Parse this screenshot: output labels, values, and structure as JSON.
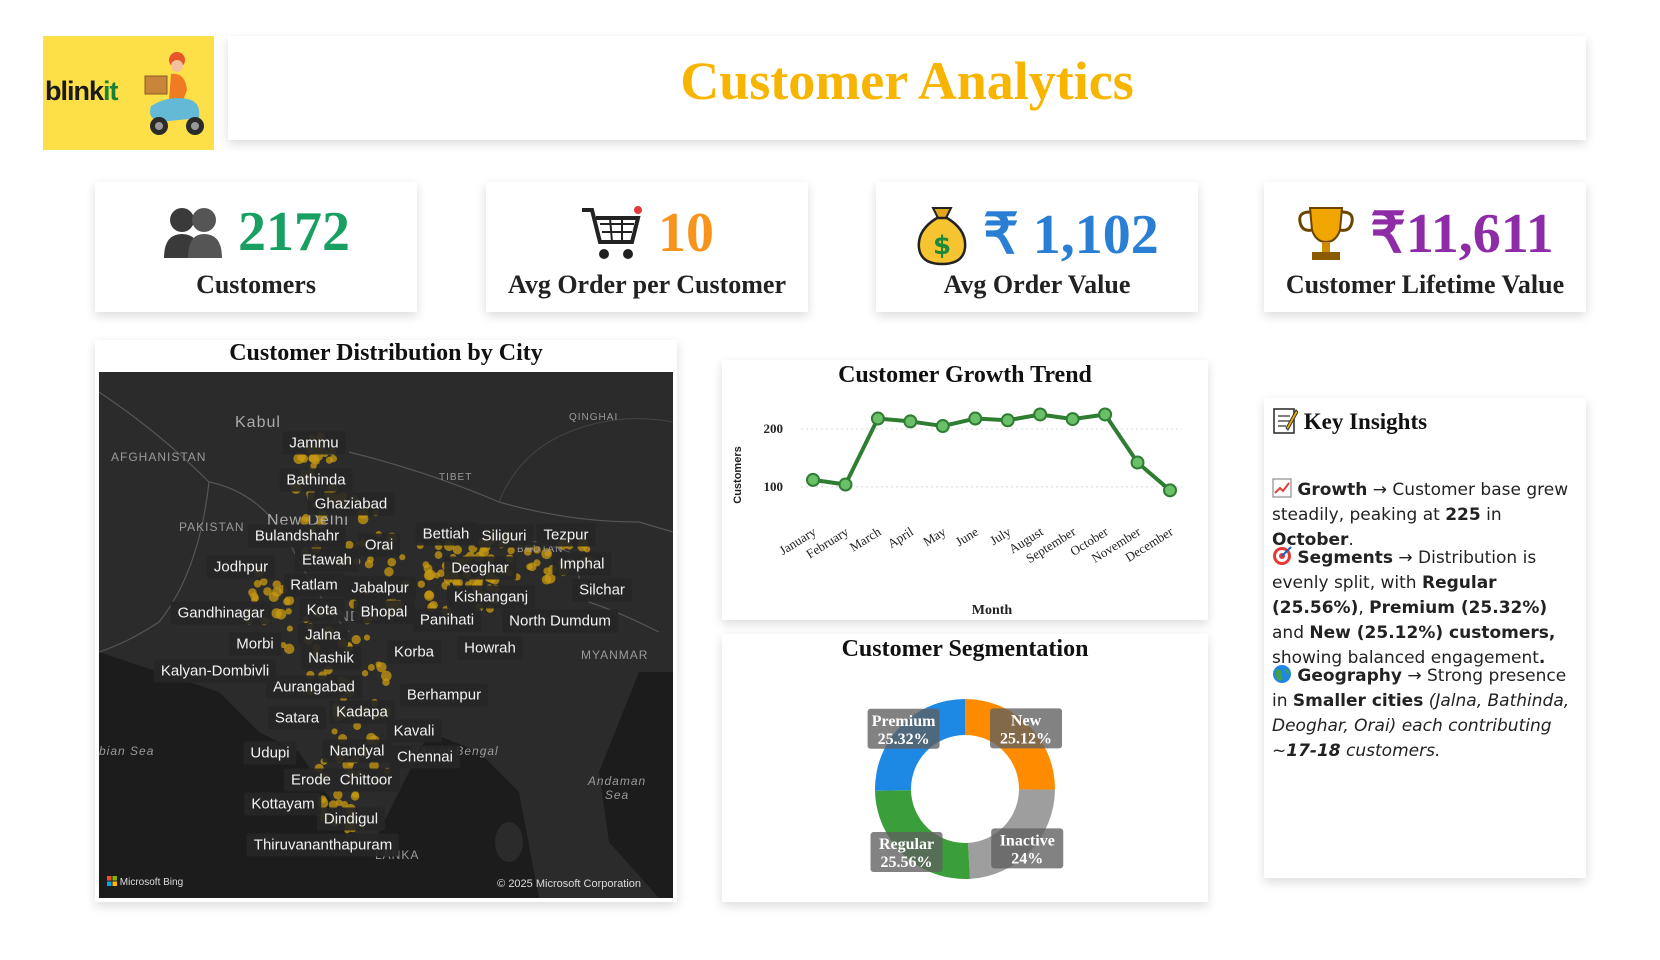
{
  "brand": {
    "logo_text_main": "blink",
    "logo_text_accent": "it",
    "scooter_icon": "delivery-scooter-icon"
  },
  "header": {
    "title": "Customer Analytics",
    "title_color": "#f7b500"
  },
  "kpis": [
    {
      "icon": "people-icon",
      "value": "2172",
      "label": "Customers",
      "color": "#17a061"
    },
    {
      "icon": "shopping-cart-icon",
      "value": "10",
      "label": "Avg Order per Customer",
      "color": "#f7941d"
    },
    {
      "icon": "money-bag-icon",
      "value": "₹ 1,102",
      "label": "Avg Order Value",
      "color": "#2a7fd4"
    },
    {
      "icon": "trophy-icon",
      "value": "₹11,611",
      "label": "Customer Lifetime Value",
      "color": "#8e2ca8"
    }
  ],
  "map": {
    "title": "Customer Distribution by City",
    "regions": [
      "AFGHANISTAN",
      "PAKISTAN",
      "Kabul",
      "TIBET",
      "QINGHAI",
      "BHUTAN",
      "MYANMAR",
      "LANKA",
      "bian Sea",
      "Andaman Sea",
      "Bay of Bengal",
      "New Delhi",
      "INDIA"
    ],
    "cities": [
      "Jammu",
      "Bathinda",
      "Ghaziabad",
      "Bulandshahr",
      "Orai",
      "Bettiah",
      "Siliguri",
      "Tezpur",
      "Etawah",
      "Jodhpur",
      "Deoghar",
      "Imphal",
      "Ratlam",
      "Jabalpur",
      "Silchar",
      "Kishanganj",
      "Gandhinagar",
      "Kota",
      "Bhopal",
      "Panihati",
      "North Dumdum",
      "Jalna",
      "Morbi",
      "Korba",
      "Howrah",
      "Nashik",
      "Kalyan-Dombivli",
      "Aurangabad",
      "Berhampur",
      "Kadapa",
      "Satara",
      "Kavali",
      "Udupi",
      "Nandyal",
      "Chennai",
      "Erode",
      "Chittoor",
      "Kottayam",
      "Dindigul",
      "Thiruvananthapuram"
    ],
    "attribution": "Microsoft Bing",
    "copyright": "© 2025 Microsoft Corporation"
  },
  "chart_data": [
    {
      "type": "line",
      "title": "Customer Growth Trend",
      "xlabel": "Month",
      "ylabel": "Customers",
      "categories": [
        "January",
        "February",
        "March",
        "April",
        "May",
        "June",
        "July",
        "August",
        "September",
        "October",
        "November",
        "December"
      ],
      "series": [
        {
          "values": [
            112,
            104,
            218,
            213,
            205,
            218,
            215,
            225,
            217,
            225,
            142,
            94
          ]
        }
      ],
      "yticks": [
        100,
        200
      ],
      "ylim": [
        60,
        250
      ],
      "grid": true,
      "color": "#2e7d32"
    },
    {
      "type": "pie",
      "title": "Customer Segmentation",
      "donut": true,
      "slices": [
        {
          "name": "New",
          "value": 25.12,
          "label": "25.12%",
          "color": "#ff8c00"
        },
        {
          "name": "Inactive",
          "value": 24,
          "label": "24%",
          "color": "#9e9e9e"
        },
        {
          "name": "Regular",
          "value": 25.56,
          "label": "25.56%",
          "color": "#3a9e3a"
        },
        {
          "name": "Premium",
          "value": 25.32,
          "label": "25.32%",
          "color": "#1e88e5"
        }
      ]
    }
  ],
  "insights": {
    "title": "Key Insights",
    "title_icon": "memo-icon",
    "growth": {
      "icon": "chart-up-icon",
      "heading": "Growth",
      "arrow": "→",
      "text1": "Customer base grew steadily, peaking at",
      "peak": "225",
      "in": "in",
      "month": "October",
      "end": "."
    },
    "segments": {
      "icon": "target-icon",
      "heading": "Segments",
      "arrow": "→",
      "text1": "Distribution is evenly split, with",
      "regular": "Regular",
      "regular_pct": "(25.56%)",
      "comma": ",",
      "premium": "Premium (25.32%)",
      "and": "and",
      "new_cust": "New (25.12%) customers,",
      "text2": "showing balanced engagement",
      "end": "."
    },
    "geography": {
      "icon": "globe-icon",
      "heading": "Geography",
      "arrow": "→",
      "text1": "Strong presence in",
      "smaller": "Smaller cities",
      "cities": "(Jalna, Bathinda, Deoghar, Orai) each contributing ~",
      "count": "17-18",
      "tail": "customers."
    }
  }
}
